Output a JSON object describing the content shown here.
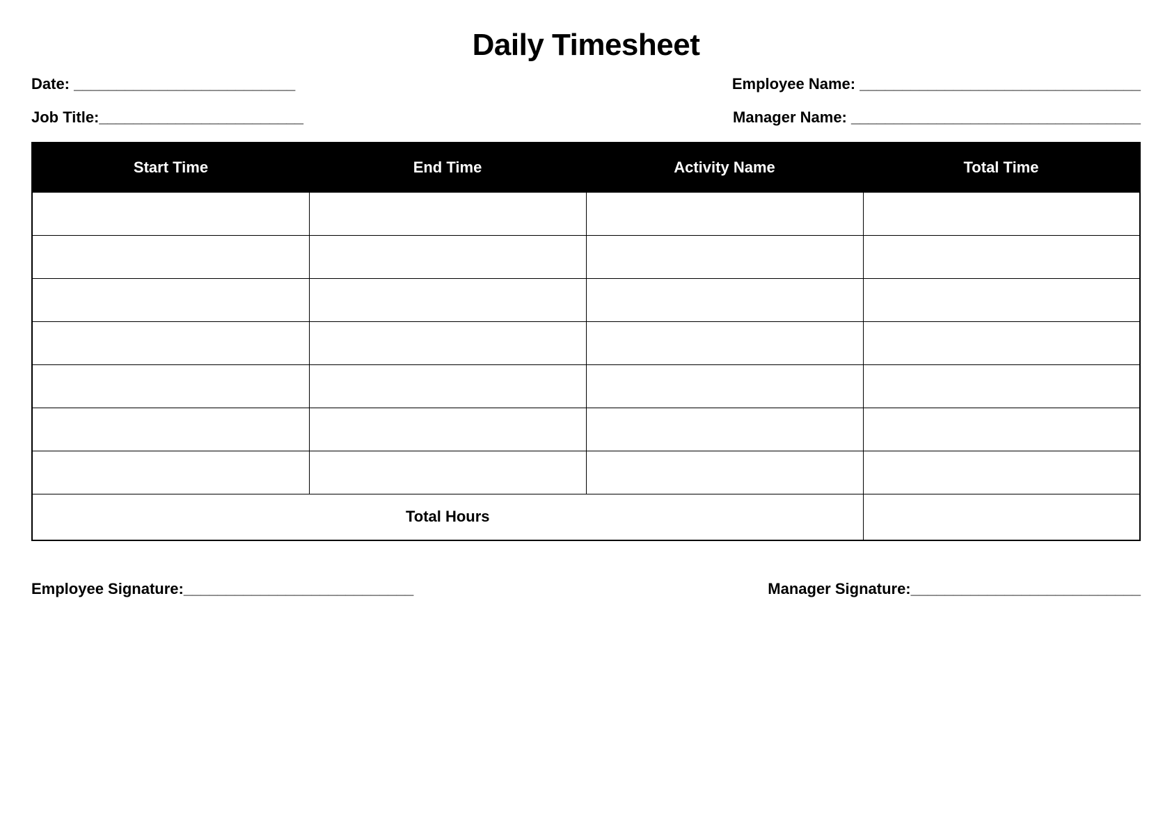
{
  "title": "Daily Timesheet",
  "fields": {
    "date": "Date: __________________________",
    "employee_name": "Employee Name: _________________________________",
    "job_title": "Job Title:________________________",
    "manager_name": "Manager Name: __________________________________"
  },
  "table": {
    "headers": {
      "start_time": "Start Time",
      "end_time": "End Time",
      "activity_name": "Activity Name",
      "total_time": "Total Time"
    },
    "total_hours_label": "Total Hours"
  },
  "signatures": {
    "employee": "Employee Signature:___________________________",
    "manager": "Manager Signature:___________________________"
  }
}
